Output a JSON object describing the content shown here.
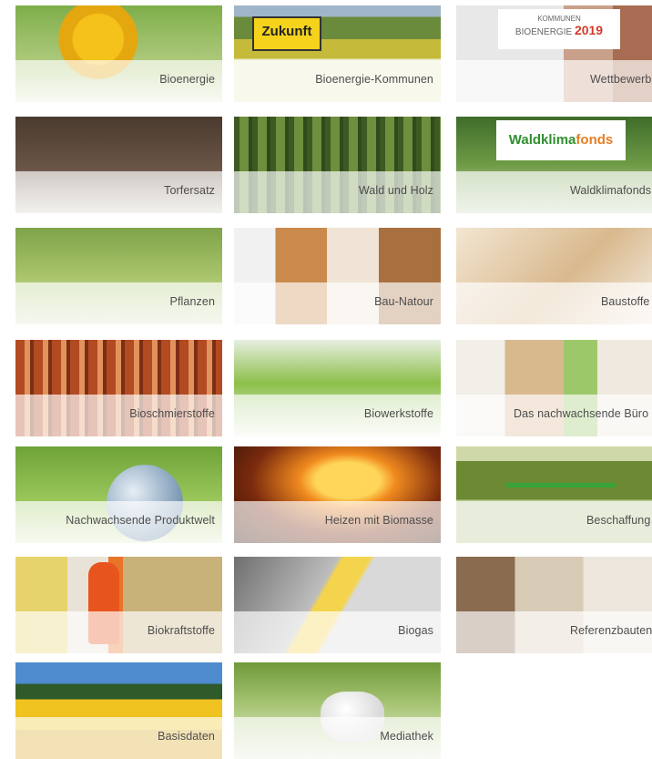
{
  "tiles": [
    {
      "label": "Bioenergie"
    },
    {
      "label": "Bioenergie-Kommunen",
      "sign": "Zukunft"
    },
    {
      "label": "Wettbewerb",
      "logo_text": "BIOENERGIE",
      "logo_sub": "KOMMUNEN",
      "logo_year": "2019"
    },
    {
      "label": "Torfersatz"
    },
    {
      "label": "Wald und Holz"
    },
    {
      "label": "Waldklimafonds",
      "logo_text_a": "Waldklima",
      "logo_text_b": "fonds"
    },
    {
      "label": "Pflanzen"
    },
    {
      "label": "Bau-Natour"
    },
    {
      "label": "Baustoffe"
    },
    {
      "label": "Bioschmierstoffe"
    },
    {
      "label": "Biowerkstoffe"
    },
    {
      "label": "Das nachwachsende Büro"
    },
    {
      "label": "Nachwachsende Produktwelt"
    },
    {
      "label": "Heizen mit Biomasse"
    },
    {
      "label": "Beschaffung"
    },
    {
      "label": "Biokraftstoffe"
    },
    {
      "label": "Biogas"
    },
    {
      "label": "Referenzbauten"
    },
    {
      "label": "Basisdaten"
    },
    {
      "label": "Mediathek"
    }
  ]
}
